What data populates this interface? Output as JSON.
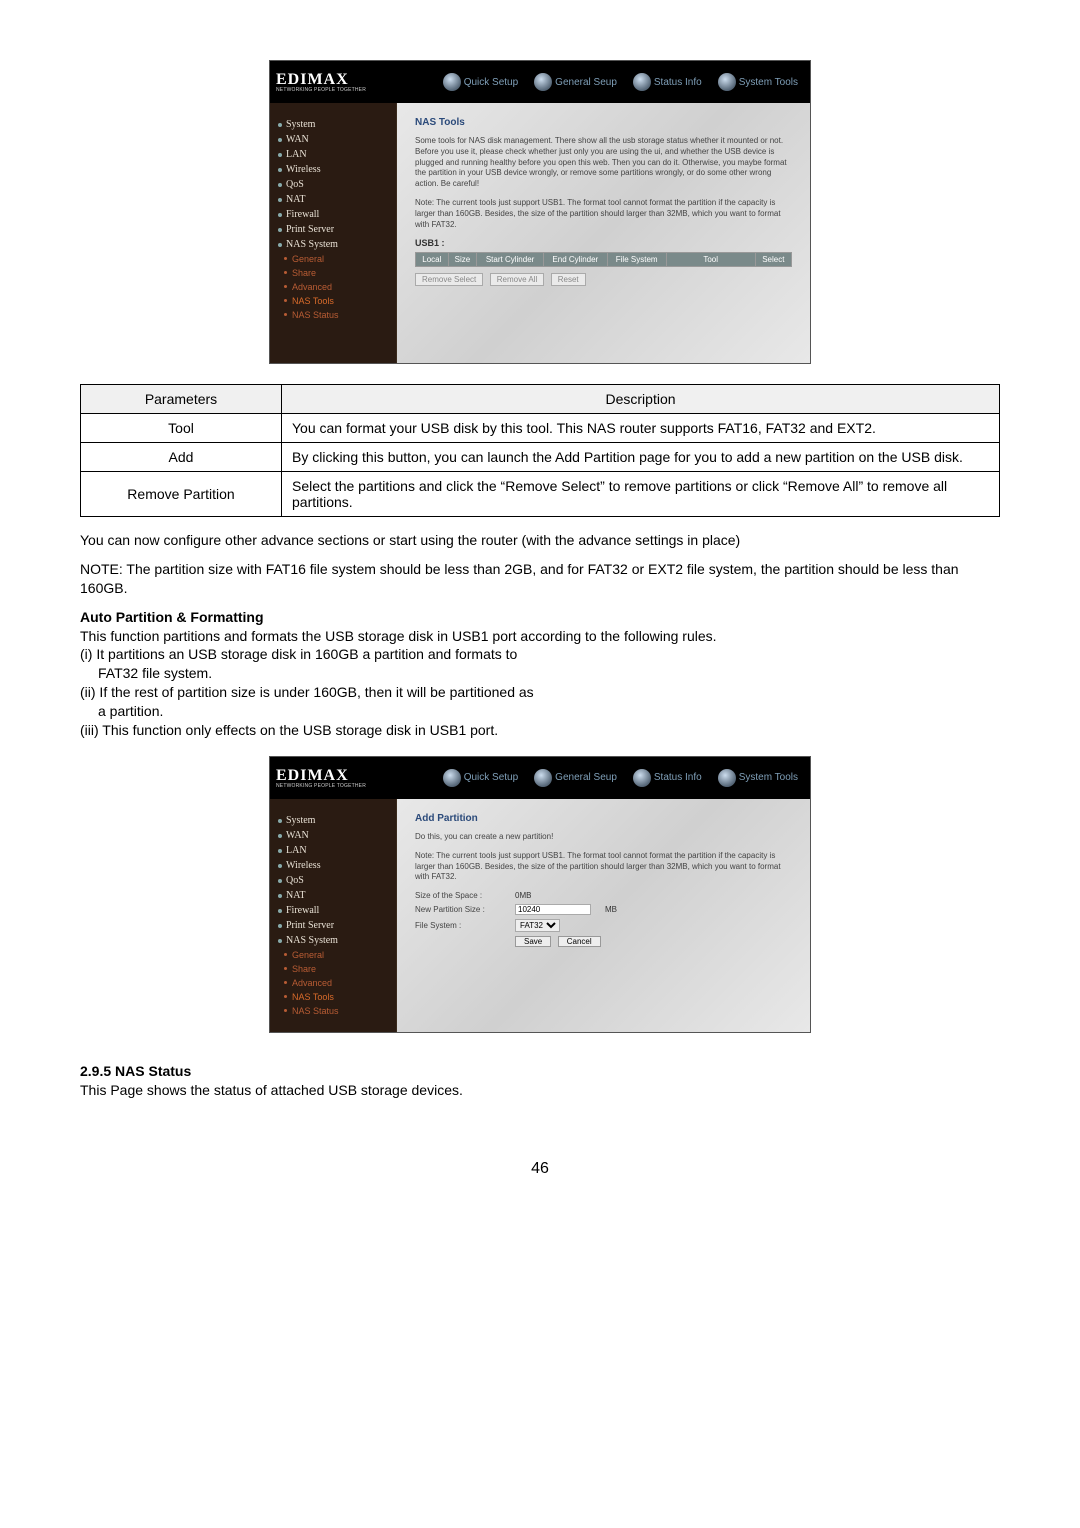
{
  "brand": {
    "name": "EDIMAX",
    "tagline": "NETWORKING PEOPLE TOGETHER"
  },
  "header_tabs": {
    "quick": "Quick Setup",
    "general": "General Seup",
    "status": "Status Info",
    "tools": "System Tools"
  },
  "sidebar": {
    "items": [
      "System",
      "WAN",
      "LAN",
      "Wireless",
      "QoS",
      "NAT",
      "Firewall",
      "Print Server",
      "NAS System"
    ],
    "subs": [
      "General",
      "Share",
      "Advanced",
      "NAS Tools",
      "NAS Status"
    ]
  },
  "nas_tools": {
    "title": "NAS Tools",
    "para1": "Some tools for NAS disk management. There show all the usb storage status whether it mounted or not. Before you use it, please check whether just only you are using the ui, and whether the USB device is plugged and running healthy before you open this web. Then you can do it. Otherwise, you maybe format the partition in your USB device wrongly, or remove some partitions wrongly, or do some other wrong action. Be careful!",
    "para2": "Note: The current tools just support USB1. The format tool cannot format the partition if the capacity is larger than 160GB. Besides, the size of the partition should larger than 32MB, which you want to format with FAT32.",
    "usb": "USB1 :",
    "cols": [
      "Local",
      "Size",
      "Start Cylinder",
      "End Cylinder",
      "File System",
      "Tool",
      "Select"
    ],
    "btns": {
      "remove_select": "Remove Select",
      "remove_all": "Remove All",
      "reset": "Reset"
    }
  },
  "doc_table": {
    "h1": "Parameters",
    "h2": "Description",
    "rows": [
      {
        "p": "Tool",
        "d": "You can format your USB disk by this tool. This NAS router supports FAT16, FAT32 and EXT2."
      },
      {
        "p": "Add",
        "d": "By clicking this button, you can launch the Add Partition page for you to add a new partition on the USB disk."
      },
      {
        "p": "Remove Partition",
        "d": "Select the partitions and click the “Remove Select” to remove partitions or click “Remove All” to remove all partitions."
      }
    ]
  },
  "body": {
    "configure": "You can now configure other advance sections or start using the router (with the advance settings in place)",
    "note": "NOTE: The partition size with FAT16 file system should be less than 2GB, and for FAT32 or EXT2 file system, the partition should be less than 160GB.",
    "auto_heading": "Auto Partition & Formatting",
    "auto_intro": "This function partitions and formats the USB storage disk in USB1 port according to the following rules.",
    "rule1a": "(i) It partitions an USB storage disk in 160GB a partition and formats to",
    "rule1b": "FAT32 file system.",
    "rule2a": "(ii) If the rest of partition size is under 160GB, then it will be partitioned as",
    "rule2b": "a partition.",
    "rule3": "(iii) This function only effects on the USB storage disk in USB1 port."
  },
  "add_partition": {
    "title": "Add Partition",
    "intro": "Do this, you can create a new partition!",
    "note": "Note: The current tools just support USB1. The format tool cannot format the partition if the capacity is larger than 160GB. Besides, the size of the partition should larger than 32MB, which you want to format with FAT32.",
    "size_label": "Size of the Space :",
    "size_value": "0MB",
    "newpart_label": "New Partition Size :",
    "newpart_value": "10240",
    "mb": "MB",
    "fs_label": "File System :",
    "fs_value": "FAT32",
    "save": "Save",
    "cancel": "Cancel"
  },
  "status_heading": "2.9.5 NAS Status",
  "status_text": "This Page shows the status of attached USB storage devices.",
  "page_num": "46"
}
